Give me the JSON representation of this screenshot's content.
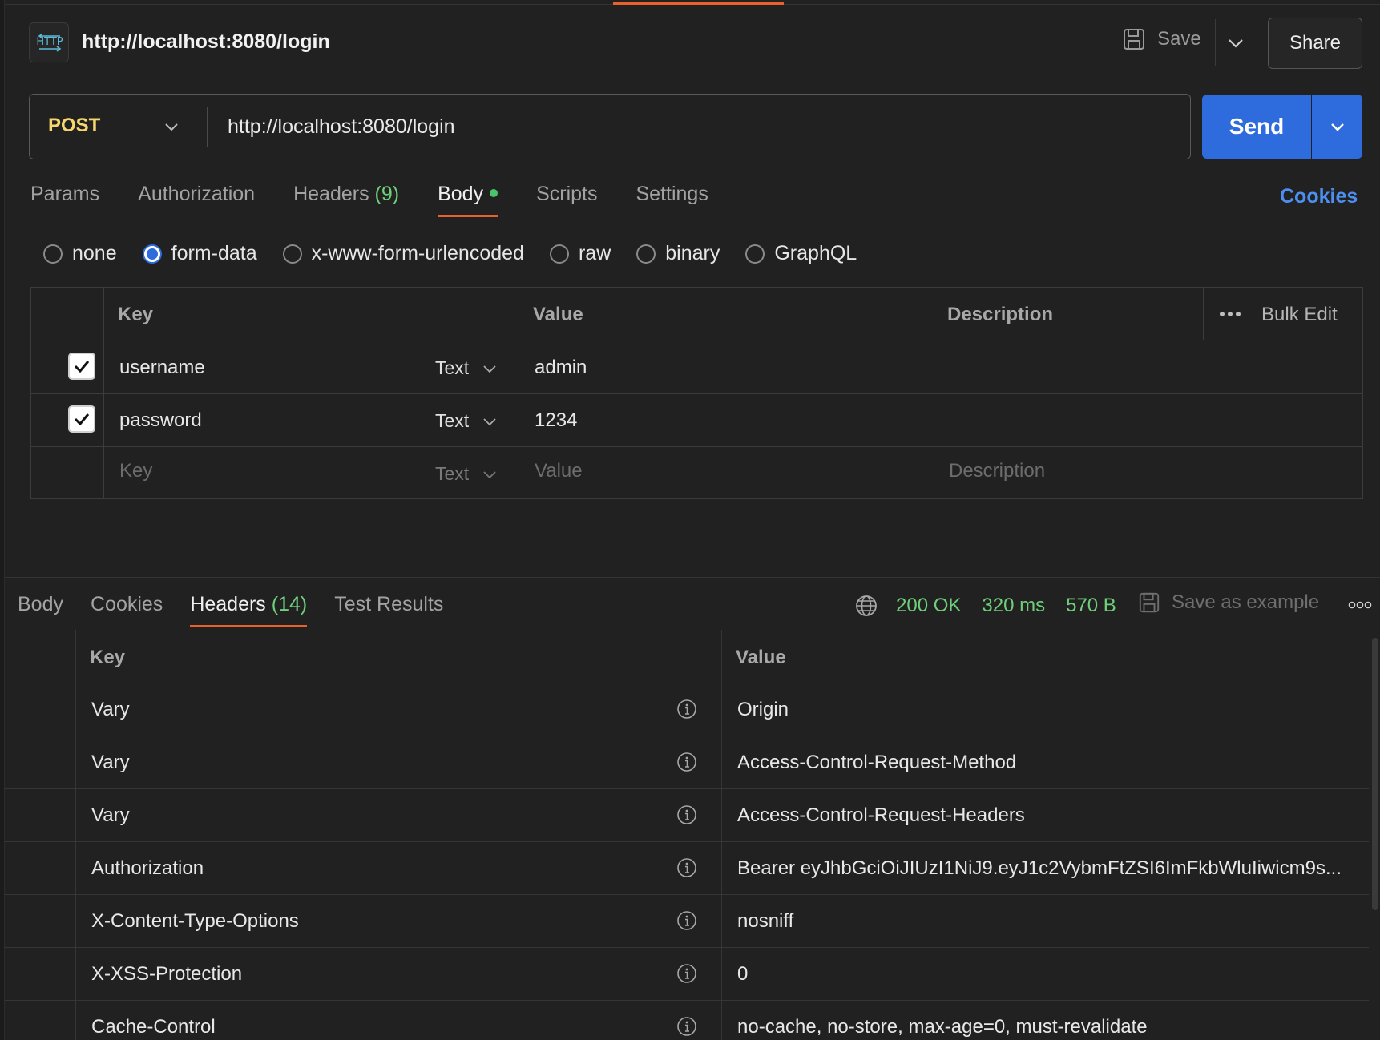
{
  "header": {
    "icon_label": "HTTP",
    "title": "http://localhost:8080/login",
    "save_label": "Save",
    "share_label": "Share"
  },
  "request": {
    "method": "POST",
    "url": "http://localhost:8080/login",
    "send_label": "Send",
    "cookies_label": "Cookies",
    "tabs": [
      {
        "label": "Params"
      },
      {
        "label": "Authorization"
      },
      {
        "label": "Headers",
        "count": "(9)"
      },
      {
        "label": "Body"
      },
      {
        "label": "Scripts"
      },
      {
        "label": "Settings"
      }
    ],
    "body_types": [
      "none",
      "form-data",
      "x-www-form-urlencoded",
      "raw",
      "binary",
      "GraphQL"
    ],
    "selected_body_type": "form-data"
  },
  "form_table": {
    "headers": {
      "key": "Key",
      "value": "Value",
      "description": "Description",
      "bulk_edit": "Bulk Edit"
    },
    "rows": [
      {
        "checked": true,
        "key": "username",
        "type": "Text",
        "value": "admin"
      },
      {
        "checked": true,
        "key": "password",
        "type": "Text",
        "value": "1234"
      }
    ],
    "new_row": {
      "key_placeholder": "Key",
      "type": "Text",
      "value_placeholder": "Value",
      "description_placeholder": "Description"
    }
  },
  "response": {
    "tabs": [
      {
        "label": "Body"
      },
      {
        "label": "Cookies"
      },
      {
        "label": "Headers",
        "count": "(14)"
      },
      {
        "label": "Test Results"
      }
    ],
    "active_tab": "Headers",
    "status": "200 OK",
    "time": "320 ms",
    "size": "570 B",
    "save_example_label": "Save as example",
    "headers_table": {
      "key_header": "Key",
      "value_header": "Value",
      "rows": [
        {
          "key": "Vary",
          "value": "Origin"
        },
        {
          "key": "Vary",
          "value": "Access-Control-Request-Method"
        },
        {
          "key": "Vary",
          "value": "Access-Control-Request-Headers"
        },
        {
          "key": "Authorization",
          "value": "Bearer eyJhbGciOiJIUzI1NiJ9.eyJ1c2VybmFtZSI6ImFkbWluIiwicm9s..."
        },
        {
          "key": "X-Content-Type-Options",
          "value": "nosniff"
        },
        {
          "key": "X-XSS-Protection",
          "value": "0"
        },
        {
          "key": "Cache-Control",
          "value": "no-cache, no-store, max-age=0, must-revalidate"
        }
      ]
    }
  },
  "colors": {
    "accent_orange": "#e8602c",
    "send_blue": "#2e6bdc",
    "status_green": "#6fcf7a",
    "method_yellow": "#f5d76e",
    "link_blue": "#4d8ff0"
  }
}
